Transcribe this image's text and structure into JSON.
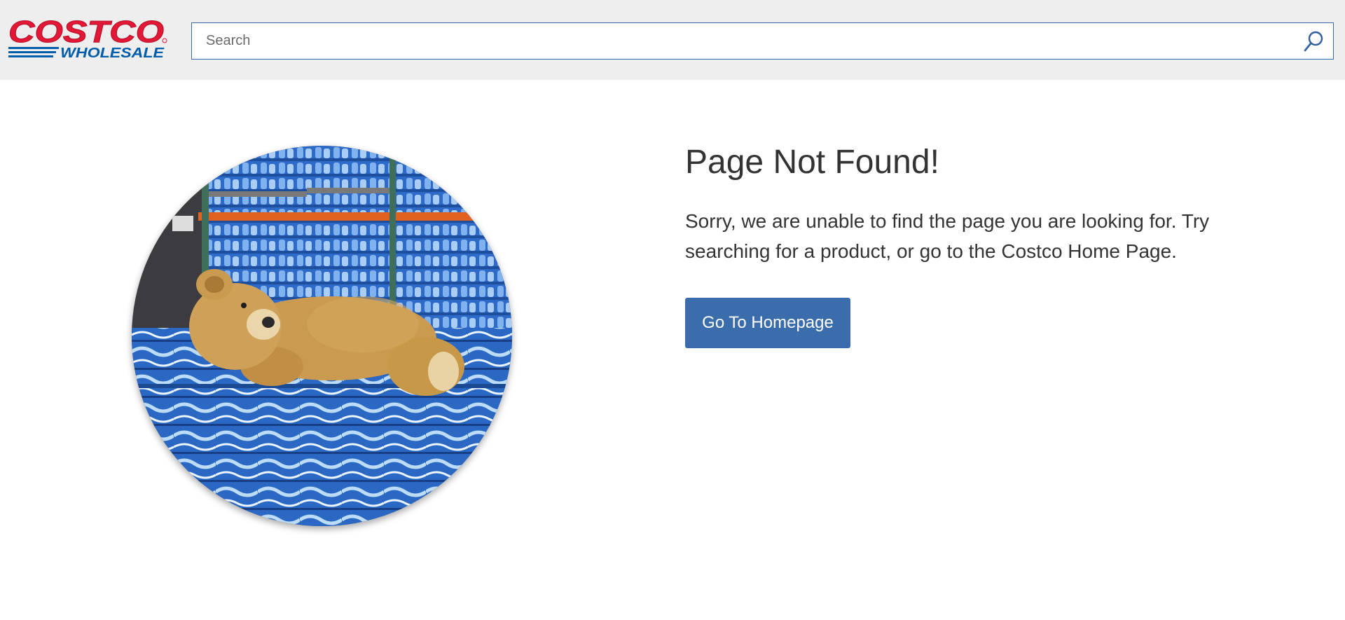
{
  "header": {
    "logo": {
      "brand": "COSTCO",
      "sub_brand": "WHOLESALE",
      "colors": {
        "red": "#e31837",
        "blue": "#005daa"
      }
    },
    "search": {
      "placeholder": "Search",
      "value": "",
      "icon": "search-icon"
    }
  },
  "main": {
    "image": {
      "subject": "teddy-bear-on-water-pallets",
      "shape": "circle"
    },
    "title": "Page Not Found!",
    "message": "Sorry, we are unable to find the page you are looking for. Try searching for a product, or go to the Costco Home Page.",
    "button_label": "Go To Homepage",
    "colors": {
      "button": "#3b6dac",
      "button_text": "#ffffff",
      "text": "#333333"
    }
  }
}
